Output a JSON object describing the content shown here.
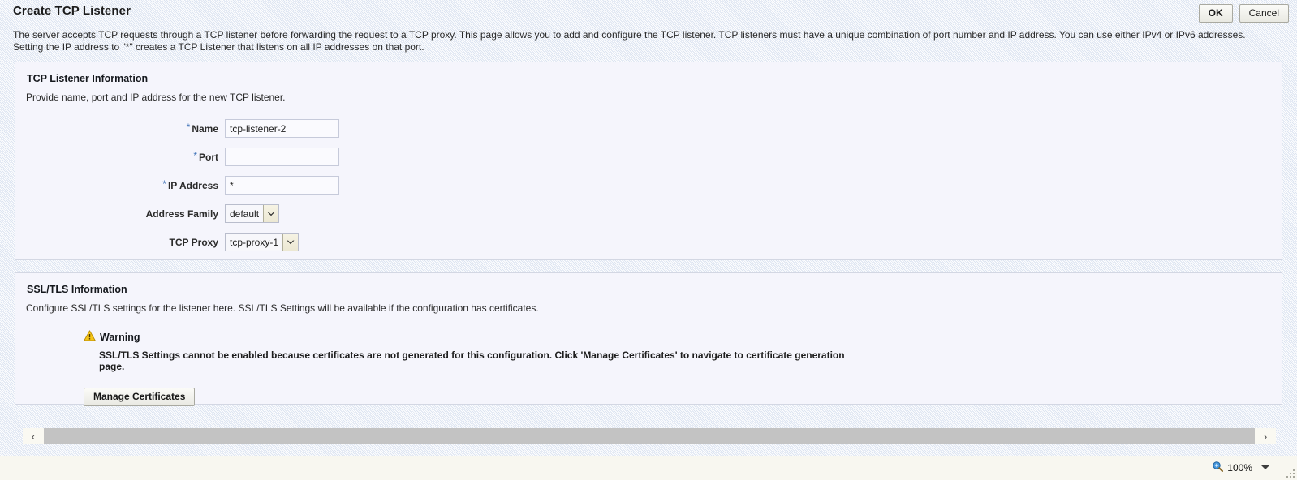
{
  "header": {
    "title": "Create TCP Listener",
    "ok_label": "OK",
    "cancel_label": "Cancel"
  },
  "intro": {
    "line1": "The server accepts TCP requests through a TCP listener before forwarding the request to a TCP proxy. This page allows you to add and configure the TCP listener. TCP listeners must have a unique combination of port number and IP address. You can use either IPv4 or IPv6 addresses.",
    "line2": "Setting the IP address to \"*\" creates a TCP Listener that listens on all IP addresses on that port."
  },
  "listener_section": {
    "title": "TCP Listener Information",
    "description": "Provide name, port and IP address for the new TCP listener.",
    "fields": {
      "name": {
        "label": "Name",
        "required_mark": "*",
        "value": "tcp-listener-2"
      },
      "port": {
        "label": "Port",
        "required_mark": "*",
        "value": ""
      },
      "ip_address": {
        "label": "IP Address",
        "required_mark": "*",
        "value": "*"
      },
      "address_family": {
        "label": "Address Family",
        "value": "default"
      },
      "tcp_proxy": {
        "label": "TCP Proxy",
        "value": "tcp-proxy-1"
      }
    }
  },
  "ssl_section": {
    "title": "SSL/TLS Information",
    "description": "Configure SSL/TLS settings for the listener here. SSL/TLS Settings will be available if the configuration has certificates.",
    "warning": {
      "heading": "Warning",
      "icon": "warning-triangle-icon",
      "message": "SSL/TLS Settings cannot be enabled because certificates are not generated for this configuration. Click 'Manage Certificates' to navigate to certificate generation page."
    },
    "manage_certificates_label": "Manage Certificates"
  },
  "scrollbar": {
    "left_arrow": "‹",
    "right_arrow": "›"
  },
  "statusbar": {
    "zoom_icon": "zoom-magnifier-icon",
    "zoom_level": "100%"
  },
  "colors": {
    "panel_bg": "#f5f5fc",
    "panel_border": "#d3d7e3",
    "required_asterisk": "#3b6fb6",
    "warning_yellow": "#f5c518",
    "scroll_thumb": "#c3c3c3"
  }
}
